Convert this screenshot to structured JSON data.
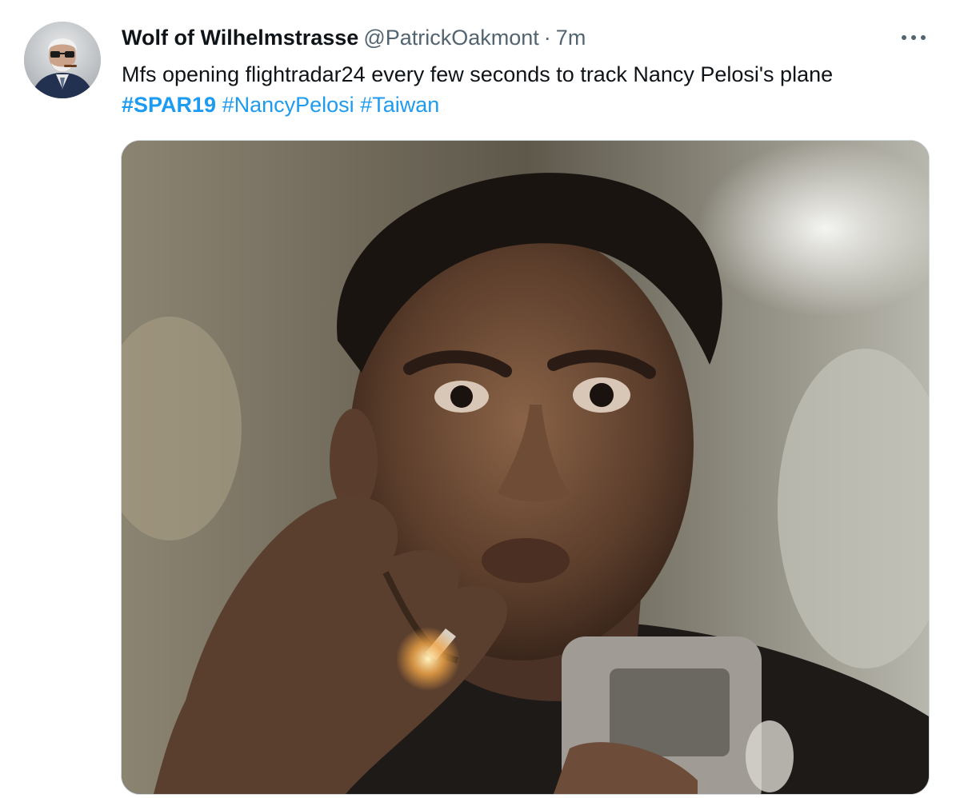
{
  "tweet": {
    "author": {
      "display_name": "Wolf of Wilhelmstrasse",
      "handle": "@PatrickOakmont",
      "separator": "·",
      "timestamp": "7m"
    },
    "text": "Mfs opening flightradar24 every few seconds to track Nancy Pelosi's plane",
    "hashtags": [
      "#SPAR19",
      "#NancyPelosi",
      "#Taiwan"
    ],
    "more_icon": "more-horizontal-icon",
    "media": {
      "type": "photo",
      "subject": "man-smoking-staring-at-phone"
    }
  },
  "colors": {
    "link": "#1d9bf0",
    "text_primary": "#0f1419",
    "text_secondary": "#536471",
    "border": "#cfd9de"
  }
}
